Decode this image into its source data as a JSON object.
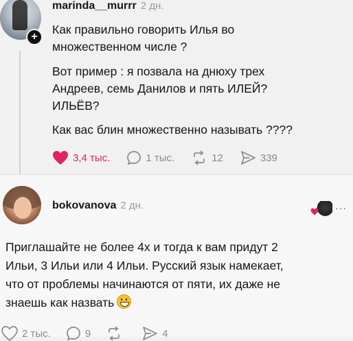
{
  "post": {
    "username": "marinda__murrr",
    "time": "2 дн.",
    "line1": "Как правильно говорить Илья во\nмножественном числе ?",
    "line2": "Вот пример : я позвала на днюху трех\nАндреев, семь Данилов и пять ИЛЕЙ?\nИЛЬЁВ?",
    "line3": "Как вас блин множественно называть ????",
    "likes": "3,4 тыс.",
    "replies": "1 тыс.",
    "reposts": "12",
    "shares": "339"
  },
  "comment": {
    "username": "bokovanova",
    "time": "2 дн.",
    "more_label": "···",
    "text": "Приглашайте не более 4х и тогда к вам придут 2\nИльи, 3 Ильи или 4 Ильи. Русский язык намекает,\nчто от проблемы начинаются от пяти, их даже не\nзнаешь как назвать",
    "likes": "2 тыс.",
    "replies": "9",
    "shares": "4"
  },
  "colors": {
    "like_red": "#e0245e",
    "muted": "#8a8a8a"
  }
}
